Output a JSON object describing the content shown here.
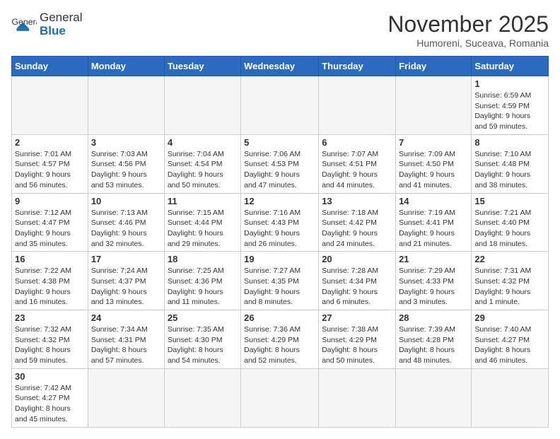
{
  "header": {
    "logo_general": "General",
    "logo_blue": "Blue",
    "month": "November 2025",
    "location": "Humoreni, Suceava, Romania"
  },
  "weekdays": [
    "Sunday",
    "Monday",
    "Tuesday",
    "Wednesday",
    "Thursday",
    "Friday",
    "Saturday"
  ],
  "weeks": [
    [
      {
        "day": "",
        "info": ""
      },
      {
        "day": "",
        "info": ""
      },
      {
        "day": "",
        "info": ""
      },
      {
        "day": "",
        "info": ""
      },
      {
        "day": "",
        "info": ""
      },
      {
        "day": "",
        "info": ""
      },
      {
        "day": "1",
        "info": "Sunrise: 6:59 AM\nSunset: 4:59 PM\nDaylight: 9 hours\nand 59 minutes."
      }
    ],
    [
      {
        "day": "2",
        "info": "Sunrise: 7:01 AM\nSunset: 4:57 PM\nDaylight: 9 hours\nand 56 minutes."
      },
      {
        "day": "3",
        "info": "Sunrise: 7:03 AM\nSunset: 4:56 PM\nDaylight: 9 hours\nand 53 minutes."
      },
      {
        "day": "4",
        "info": "Sunrise: 7:04 AM\nSunset: 4:54 PM\nDaylight: 9 hours\nand 50 minutes."
      },
      {
        "day": "5",
        "info": "Sunrise: 7:06 AM\nSunset: 4:53 PM\nDaylight: 9 hours\nand 47 minutes."
      },
      {
        "day": "6",
        "info": "Sunrise: 7:07 AM\nSunset: 4:51 PM\nDaylight: 9 hours\nand 44 minutes."
      },
      {
        "day": "7",
        "info": "Sunrise: 7:09 AM\nSunset: 4:50 PM\nDaylight: 9 hours\nand 41 minutes."
      },
      {
        "day": "8",
        "info": "Sunrise: 7:10 AM\nSunset: 4:48 PM\nDaylight: 9 hours\nand 38 minutes."
      }
    ],
    [
      {
        "day": "9",
        "info": "Sunrise: 7:12 AM\nSunset: 4:47 PM\nDaylight: 9 hours\nand 35 minutes."
      },
      {
        "day": "10",
        "info": "Sunrise: 7:13 AM\nSunset: 4:46 PM\nDaylight: 9 hours\nand 32 minutes."
      },
      {
        "day": "11",
        "info": "Sunrise: 7:15 AM\nSunset: 4:44 PM\nDaylight: 9 hours\nand 29 minutes."
      },
      {
        "day": "12",
        "info": "Sunrise: 7:16 AM\nSunset: 4:43 PM\nDaylight: 9 hours\nand 26 minutes."
      },
      {
        "day": "13",
        "info": "Sunrise: 7:18 AM\nSunset: 4:42 PM\nDaylight: 9 hours\nand 24 minutes."
      },
      {
        "day": "14",
        "info": "Sunrise: 7:19 AM\nSunset: 4:41 PM\nDaylight: 9 hours\nand 21 minutes."
      },
      {
        "day": "15",
        "info": "Sunrise: 7:21 AM\nSunset: 4:40 PM\nDaylight: 9 hours\nand 18 minutes."
      }
    ],
    [
      {
        "day": "16",
        "info": "Sunrise: 7:22 AM\nSunset: 4:38 PM\nDaylight: 9 hours\nand 16 minutes."
      },
      {
        "day": "17",
        "info": "Sunrise: 7:24 AM\nSunset: 4:37 PM\nDaylight: 9 hours\nand 13 minutes."
      },
      {
        "day": "18",
        "info": "Sunrise: 7:25 AM\nSunset: 4:36 PM\nDaylight: 9 hours\nand 11 minutes."
      },
      {
        "day": "19",
        "info": "Sunrise: 7:27 AM\nSunset: 4:35 PM\nDaylight: 9 hours\nand 8 minutes."
      },
      {
        "day": "20",
        "info": "Sunrise: 7:28 AM\nSunset: 4:34 PM\nDaylight: 9 hours\nand 6 minutes."
      },
      {
        "day": "21",
        "info": "Sunrise: 7:29 AM\nSunset: 4:33 PM\nDaylight: 9 hours\nand 3 minutes."
      },
      {
        "day": "22",
        "info": "Sunrise: 7:31 AM\nSunset: 4:32 PM\nDaylight: 9 hours\nand 1 minute."
      }
    ],
    [
      {
        "day": "23",
        "info": "Sunrise: 7:32 AM\nSunset: 4:32 PM\nDaylight: 8 hours\nand 59 minutes."
      },
      {
        "day": "24",
        "info": "Sunrise: 7:34 AM\nSunset: 4:31 PM\nDaylight: 8 hours\nand 57 minutes."
      },
      {
        "day": "25",
        "info": "Sunrise: 7:35 AM\nSunset: 4:30 PM\nDaylight: 8 hours\nand 54 minutes."
      },
      {
        "day": "26",
        "info": "Sunrise: 7:36 AM\nSunset: 4:29 PM\nDaylight: 8 hours\nand 52 minutes."
      },
      {
        "day": "27",
        "info": "Sunrise: 7:38 AM\nSunset: 4:29 PM\nDaylight: 8 hours\nand 50 minutes."
      },
      {
        "day": "28",
        "info": "Sunrise: 7:39 AM\nSunset: 4:28 PM\nDaylight: 8 hours\nand 48 minutes."
      },
      {
        "day": "29",
        "info": "Sunrise: 7:40 AM\nSunset: 4:27 PM\nDaylight: 8 hours\nand 46 minutes."
      }
    ],
    [
      {
        "day": "30",
        "info": "Sunrise: 7:42 AM\nSunset: 4:27 PM\nDaylight: 8 hours\nand 45 minutes."
      },
      {
        "day": "",
        "info": ""
      },
      {
        "day": "",
        "info": ""
      },
      {
        "day": "",
        "info": ""
      },
      {
        "day": "",
        "info": ""
      },
      {
        "day": "",
        "info": ""
      },
      {
        "day": "",
        "info": ""
      }
    ]
  ]
}
